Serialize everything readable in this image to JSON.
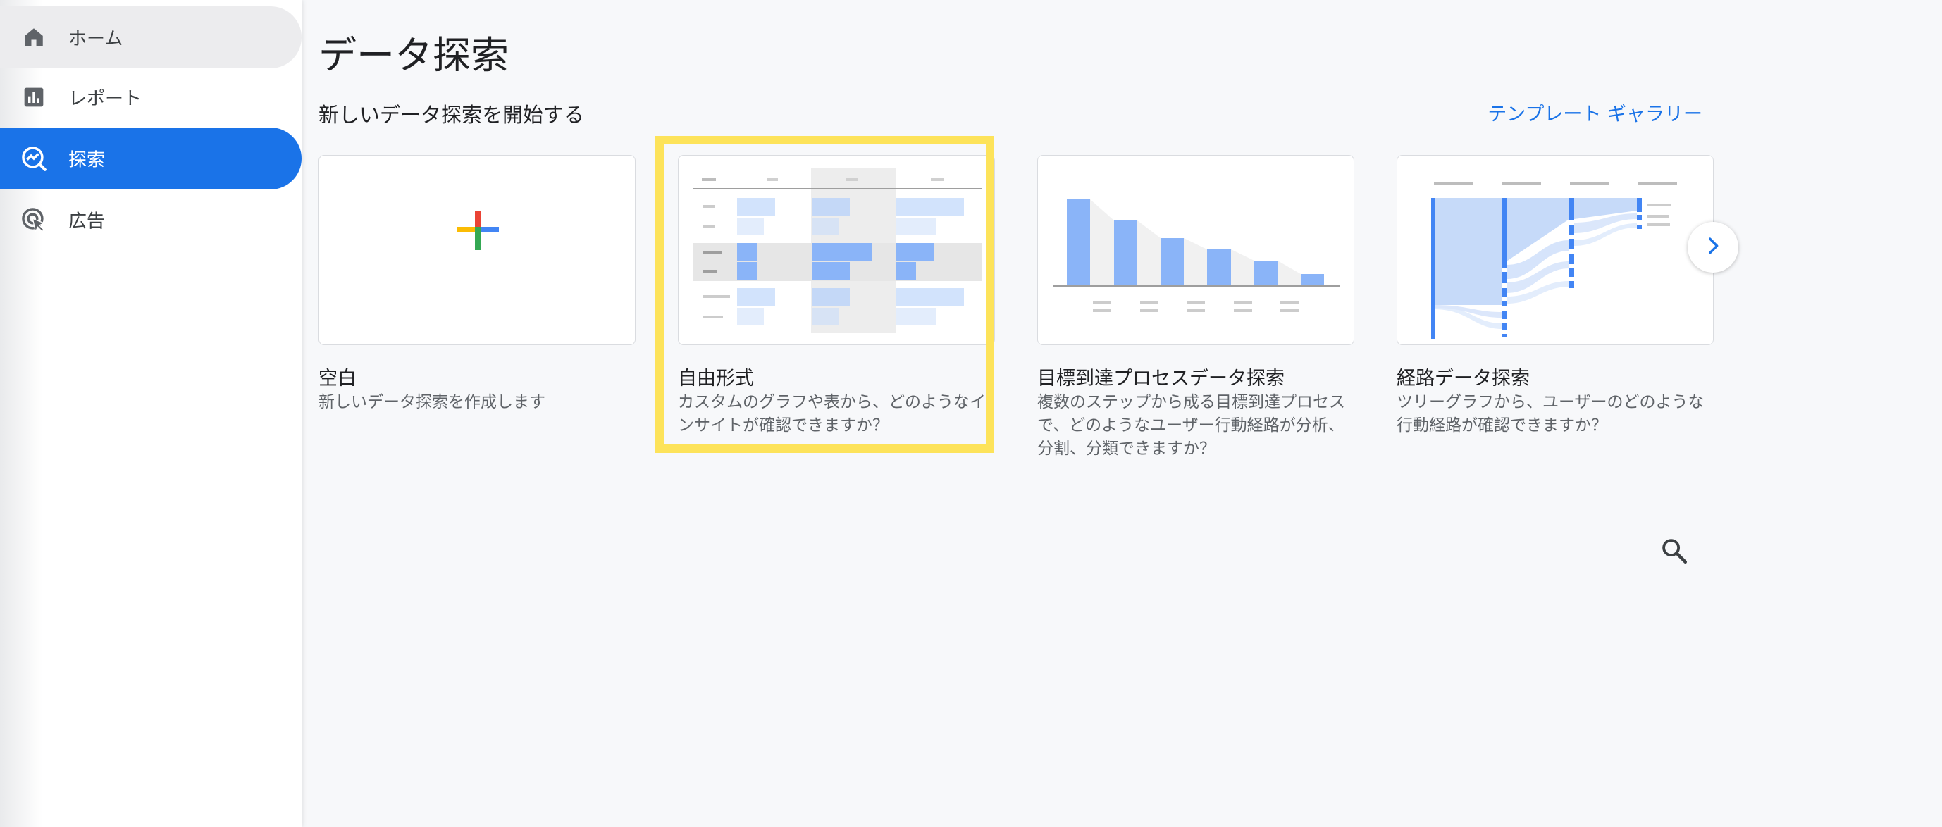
{
  "sidebar": {
    "items": [
      {
        "label": "ホーム",
        "icon": "home-icon"
      },
      {
        "label": "レポート",
        "icon": "bar-chart-icon"
      },
      {
        "label": "探索",
        "icon": "explore-icon",
        "selected": true
      },
      {
        "label": "広告",
        "icon": "ads-cursor-icon"
      }
    ]
  },
  "main": {
    "title": "データ探索",
    "section_heading": "新しいデータ探索を開始する",
    "template_link": "テンプレート ギャラリー",
    "cards": [
      {
        "title": "空白",
        "description": "新しいデータ探索を作成します"
      },
      {
        "title": "自由形式",
        "description": "カスタムのグラフや表から、どのようなインサイトが確認できますか？"
      },
      {
        "title": "目標到達プロセスデータ探索",
        "description": "複数のステップから成る目標到達プロセスで、どのようなユーザー行動経路が分析、分割、分類できますか？"
      },
      {
        "title": "経路データ探索",
        "description": "ツリーグラフから、ユーザーのどのような行動経路が確認できますか？"
      }
    ]
  },
  "icons": {
    "next": "chevron-right-icon",
    "search": "search-icon"
  },
  "colors": {
    "accent": "#1a73e8",
    "highlight": "#fde35a",
    "chart_blue": "#8ab4f8",
    "chart_light_blue": "#d2e3fc",
    "google_red": "#ea4335",
    "google_yellow": "#fbbc04",
    "google_green": "#34a853",
    "google_blue": "#4285f4"
  }
}
